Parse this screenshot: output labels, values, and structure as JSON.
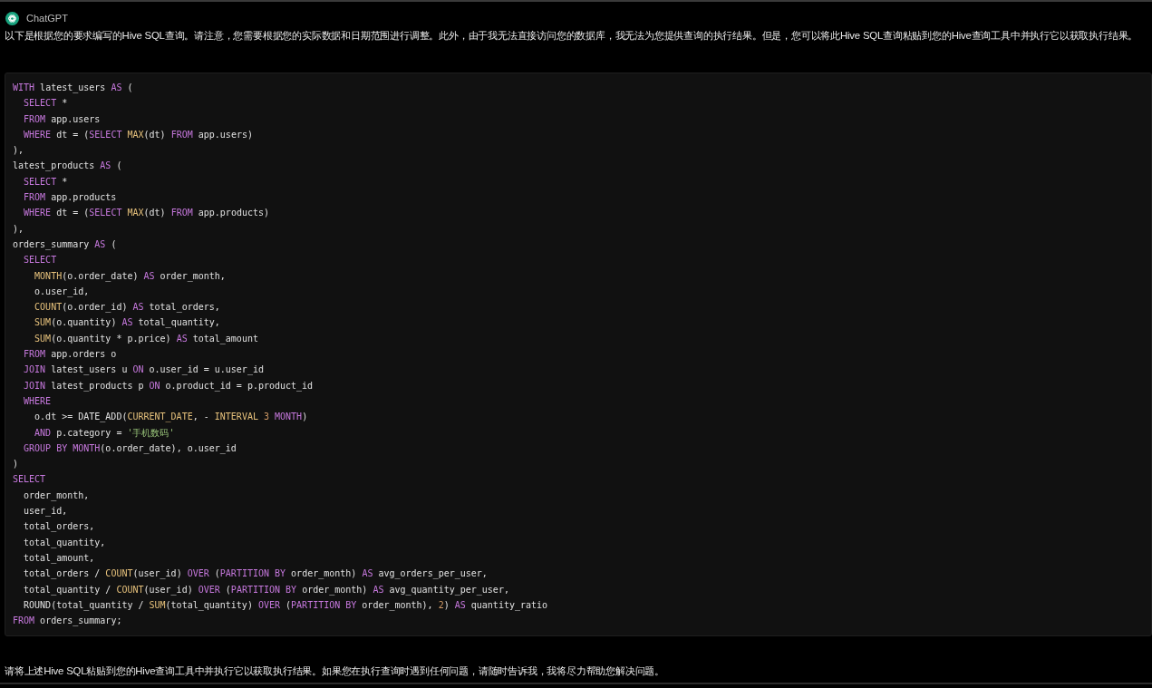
{
  "message": {
    "author": "ChatGPT",
    "intro": "以下是根据您的要求编写的Hive SQL查询。请注意，您需要根据您的实际数据和日期范围进行调整。此外，由于我无法直接访问您的数据库，我无法为您提供查询的执行结果。但是，您可以将此Hive SQL查询粘贴到您的Hive查询工具中并执行它以获取执行结果。",
    "code_lines": [
      [
        {
          "kind": "keyword",
          "text": "WITH"
        },
        {
          "kind": "plain",
          "text": " latest_users "
        },
        {
          "kind": "keyword",
          "text": "AS"
        },
        {
          "kind": "plain",
          "text": " ("
        }
      ],
      [
        {
          "kind": "keyword",
          "text": "  SELECT"
        },
        {
          "kind": "plain",
          "text": " *"
        }
      ],
      [
        {
          "kind": "keyword",
          "text": "  FROM"
        },
        {
          "kind": "plain",
          "text": " app.users"
        }
      ],
      [
        {
          "kind": "keyword",
          "text": "  WHERE"
        },
        {
          "kind": "plain",
          "text": " dt = ("
        },
        {
          "kind": "keyword",
          "text": "SELECT "
        },
        {
          "kind": "function",
          "text": "MAX"
        },
        {
          "kind": "plain",
          "text": "(dt) "
        },
        {
          "kind": "keyword",
          "text": "FROM"
        },
        {
          "kind": "plain",
          "text": " app.users)"
        }
      ],
      [
        {
          "kind": "plain",
          "text": "),"
        }
      ],
      [
        {
          "kind": "plain",
          "text": "latest_products "
        },
        {
          "kind": "keyword",
          "text": "AS"
        },
        {
          "kind": "plain",
          "text": " ("
        }
      ],
      [
        {
          "kind": "keyword",
          "text": "  SELECT"
        },
        {
          "kind": "plain",
          "text": " *"
        }
      ],
      [
        {
          "kind": "keyword",
          "text": "  FROM"
        },
        {
          "kind": "plain",
          "text": " app.products"
        }
      ],
      [
        {
          "kind": "keyword",
          "text": "  WHERE"
        },
        {
          "kind": "plain",
          "text": " dt = ("
        },
        {
          "kind": "keyword",
          "text": "SELECT "
        },
        {
          "kind": "function",
          "text": "MAX"
        },
        {
          "kind": "plain",
          "text": "(dt) "
        },
        {
          "kind": "keyword",
          "text": "FROM"
        },
        {
          "kind": "plain",
          "text": " app.products)"
        }
      ],
      [
        {
          "kind": "plain",
          "text": "),"
        }
      ],
      [
        {
          "kind": "plain",
          "text": "orders_summary "
        },
        {
          "kind": "keyword",
          "text": "AS"
        },
        {
          "kind": "plain",
          "text": " ("
        }
      ],
      [
        {
          "kind": "keyword",
          "text": "  SELECT"
        }
      ],
      [
        {
          "kind": "function",
          "text": "    MONTH"
        },
        {
          "kind": "plain",
          "text": "(o.order_date) "
        },
        {
          "kind": "keyword",
          "text": "AS"
        },
        {
          "kind": "plain",
          "text": " order_month,"
        }
      ],
      [
        {
          "kind": "plain",
          "text": "    o.user_id,"
        }
      ],
      [
        {
          "kind": "function",
          "text": "    COUNT"
        },
        {
          "kind": "plain",
          "text": "(o.order_id) "
        },
        {
          "kind": "keyword",
          "text": "AS"
        },
        {
          "kind": "plain",
          "text": " total_orders,"
        }
      ],
      [
        {
          "kind": "function",
          "text": "    SUM"
        },
        {
          "kind": "plain",
          "text": "(o.quantity) "
        },
        {
          "kind": "keyword",
          "text": "AS"
        },
        {
          "kind": "plain",
          "text": " total_quantity,"
        }
      ],
      [
        {
          "kind": "function",
          "text": "    SUM"
        },
        {
          "kind": "plain",
          "text": "(o.quantity * p.price) "
        },
        {
          "kind": "keyword",
          "text": "AS"
        },
        {
          "kind": "plain",
          "text": " total_amount"
        }
      ],
      [
        {
          "kind": "keyword",
          "text": "  FROM"
        },
        {
          "kind": "plain",
          "text": " app.orders o"
        }
      ],
      [
        {
          "kind": "keyword",
          "text": "  JOIN"
        },
        {
          "kind": "plain",
          "text": " latest_users u "
        },
        {
          "kind": "keyword",
          "text": "ON"
        },
        {
          "kind": "plain",
          "text": " o.user_id = u.user_id"
        }
      ],
      [
        {
          "kind": "keyword",
          "text": "  JOIN"
        },
        {
          "kind": "plain",
          "text": " latest_products p "
        },
        {
          "kind": "keyword",
          "text": "ON"
        },
        {
          "kind": "plain",
          "text": " o.product_id = p.product_id"
        }
      ],
      [
        {
          "kind": "keyword",
          "text": "  WHERE"
        }
      ],
      [
        {
          "kind": "plain",
          "text": "    o.dt >= DATE_ADD("
        },
        {
          "kind": "function",
          "text": "CURRENT_DATE"
        },
        {
          "kind": "plain",
          "text": ", - "
        },
        {
          "kind": "function",
          "text": "INTERVAL "
        },
        {
          "kind": "number",
          "text": "3 "
        },
        {
          "kind": "keyword",
          "text": "MONTH"
        },
        {
          "kind": "plain",
          "text": ")"
        }
      ],
      [
        {
          "kind": "keyword",
          "text": "    AND"
        },
        {
          "kind": "plain",
          "text": " p.category = "
        },
        {
          "kind": "string",
          "text": "'手机数码'"
        }
      ],
      [
        {
          "kind": "keyword",
          "text": "  GROUP BY "
        },
        {
          "kind": "keyword",
          "text": "MONTH"
        },
        {
          "kind": "plain",
          "text": "(o.order_date), o.user_id"
        }
      ],
      [
        {
          "kind": "plain",
          "text": ")"
        }
      ],
      [
        {
          "kind": "keyword",
          "text": "SELECT"
        }
      ],
      [
        {
          "kind": "plain",
          "text": "  order_month,"
        }
      ],
      [
        {
          "kind": "plain",
          "text": "  user_id,"
        }
      ],
      [
        {
          "kind": "plain",
          "text": "  total_orders,"
        }
      ],
      [
        {
          "kind": "plain",
          "text": "  total_quantity,"
        }
      ],
      [
        {
          "kind": "plain",
          "text": "  total_amount,"
        }
      ],
      [
        {
          "kind": "plain",
          "text": "  total_orders / "
        },
        {
          "kind": "function",
          "text": "COUNT"
        },
        {
          "kind": "plain",
          "text": "(user_id) "
        },
        {
          "kind": "keyword",
          "text": "OVER"
        },
        {
          "kind": "plain",
          "text": " ("
        },
        {
          "kind": "keyword",
          "text": "PARTITION BY"
        },
        {
          "kind": "plain",
          "text": " order_month) "
        },
        {
          "kind": "keyword",
          "text": "AS"
        },
        {
          "kind": "plain",
          "text": " avg_orders_per_user,"
        }
      ],
      [
        {
          "kind": "plain",
          "text": "  total_quantity / "
        },
        {
          "kind": "function",
          "text": "COUNT"
        },
        {
          "kind": "plain",
          "text": "(user_id) "
        },
        {
          "kind": "keyword",
          "text": "OVER"
        },
        {
          "kind": "plain",
          "text": " ("
        },
        {
          "kind": "keyword",
          "text": "PARTITION BY"
        },
        {
          "kind": "plain",
          "text": " order_month) "
        },
        {
          "kind": "keyword",
          "text": "AS"
        },
        {
          "kind": "plain",
          "text": " avg_quantity_per_user,"
        }
      ],
      [
        {
          "kind": "plain",
          "text": "  ROUND(total_quantity / "
        },
        {
          "kind": "function",
          "text": "SUM"
        },
        {
          "kind": "plain",
          "text": "(total_quantity) "
        },
        {
          "kind": "keyword",
          "text": "OVER"
        },
        {
          "kind": "plain",
          "text": " ("
        },
        {
          "kind": "keyword",
          "text": "PARTITION BY"
        },
        {
          "kind": "plain",
          "text": " order_month), "
        },
        {
          "kind": "number",
          "text": "2"
        },
        {
          "kind": "plain",
          "text": ") "
        },
        {
          "kind": "keyword",
          "text": "AS"
        },
        {
          "kind": "plain",
          "text": " quantity_ratio"
        }
      ],
      [
        {
          "kind": "keyword",
          "text": "FROM"
        },
        {
          "kind": "plain",
          "text": " orders_summary;"
        }
      ]
    ],
    "outro": "请将上述Hive SQL粘贴到您的Hive查询工具中并执行它以获取执行结果。如果您在执行查询时遇到任何问题，请随时告诉我，我将尽力帮助您解决问题。"
  }
}
